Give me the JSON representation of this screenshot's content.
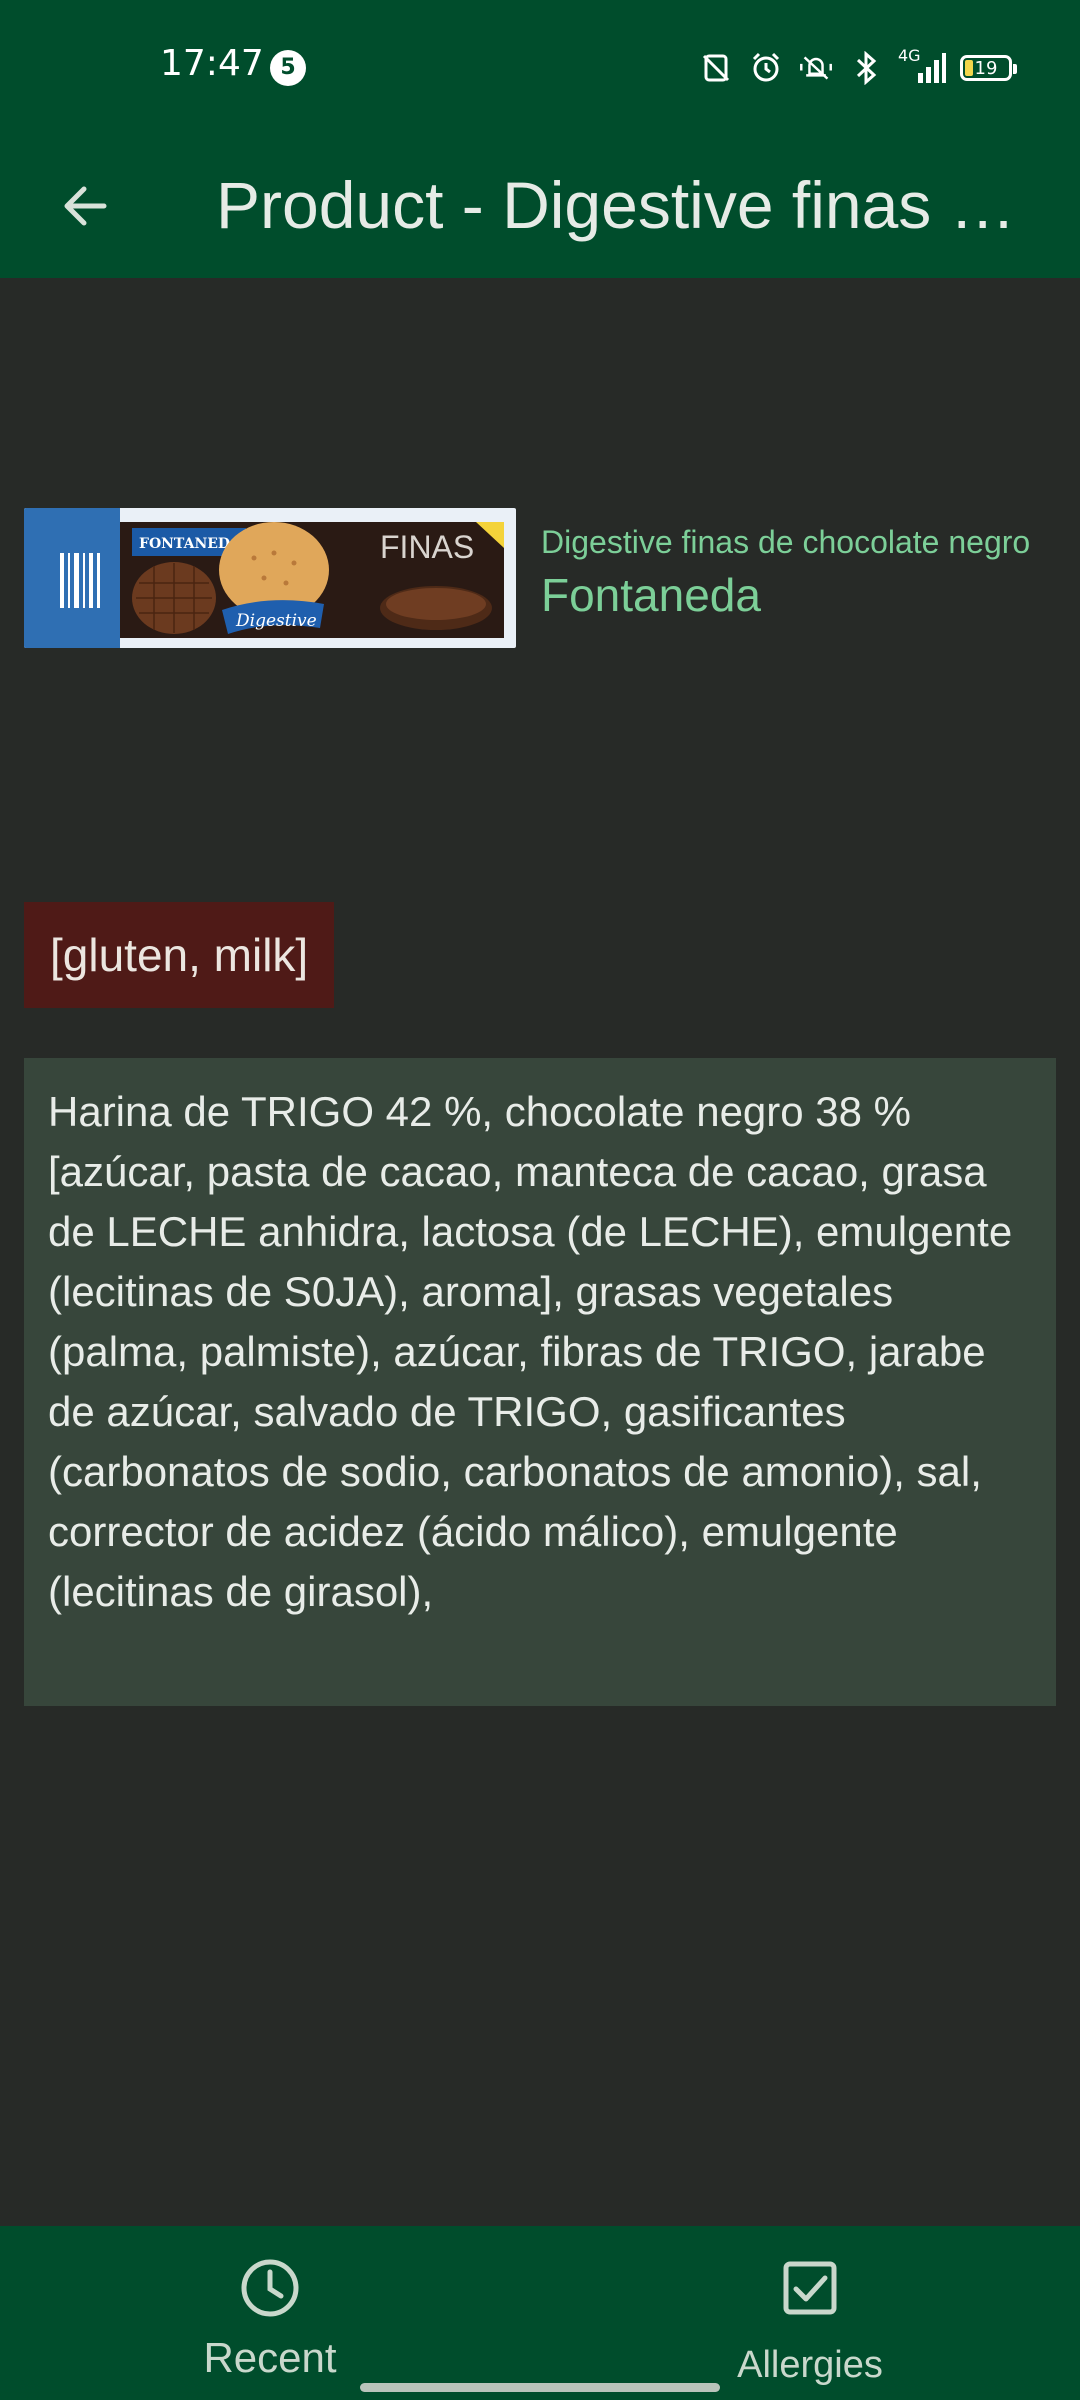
{
  "status_bar": {
    "time": "17:47",
    "notification_count": "5",
    "network": "4G",
    "battery": "19",
    "icons": [
      "nfc-off-icon",
      "alarm-icon",
      "mute-icon",
      "bluetooth-icon",
      "signal-icon",
      "battery-icon"
    ]
  },
  "app_bar": {
    "title": "Product - Digestive finas de chocolate negro",
    "back_icon": "arrow-left-icon"
  },
  "product": {
    "name": "Digestive finas de chocolate negro",
    "brand": "Fontaneda",
    "image_texts": {
      "brand_logo": "FONTANEDA",
      "product_label": "FINAS",
      "sub_label": "Digestive"
    }
  },
  "allergens": "[gluten, milk]",
  "ingredients": "Harina de TRIGO 42 %, chocolate negro 38 % [azúcar, pasta de cacao, manteca de cacao, grasa de LECHE anhidra, lactosa (de LECHE), emulgente (lecitinas de S0JA), aroma], grasas vegetales (palma, palmiste), azúcar, fibras de TRIGO, jarabe de azúcar, salvado de TRIGO, gasificantes (carbonatos de sodio, carbonatos de amonio), sal, corrector de acidez (ácido málico), emulgente (lecitinas de girasol),",
  "bottom_nav": {
    "items": [
      {
        "label": "Recent",
        "icon": "clock-icon"
      },
      {
        "label": "Allergies",
        "icon": "checkbox-icon"
      }
    ]
  },
  "colors": {
    "primary": "#004d2c",
    "background": "#272a27",
    "accent_text": "#7ccf98",
    "allergen_bg": "#4f1a17",
    "ingredients_bg": "#37463b"
  }
}
